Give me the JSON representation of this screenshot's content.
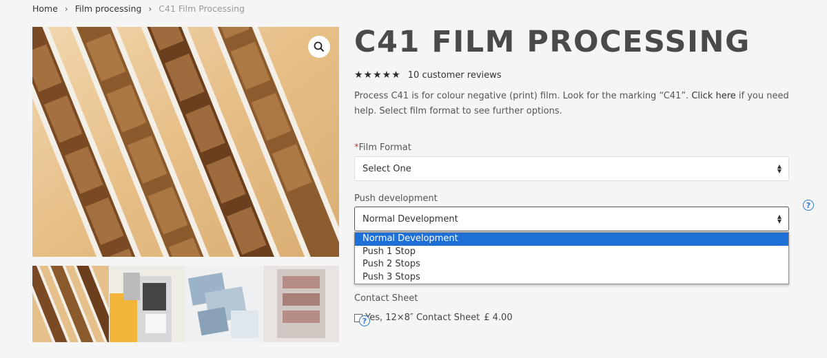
{
  "breadcrumb": {
    "home": "Home",
    "category": "Film processing",
    "current": "C41 Film Processing",
    "separator": "›"
  },
  "gallery": {
    "main_image": "film-strips-photo",
    "zoom_icon": "magnifier-icon",
    "thumbnails": [
      "film-strips-thumb",
      "120-film-roll-thumb",
      "contact-sheets-thumb",
      "negatives-sleeve-thumb"
    ]
  },
  "product": {
    "title": "C41 FILM PROCESSING",
    "stars": "★★★★★",
    "rating": 5,
    "reviews": "10 customer reviews",
    "description_pre": "Process C41 is for colour negative (print) film. Look for the marking “C41”.",
    "description_link": "Click here",
    "description_post": "if you need help. Select film format to see further options."
  },
  "form": {
    "film_format": {
      "required_mark": "*",
      "label": "Film Format",
      "value": "Select One"
    },
    "push": {
      "label": "Push development",
      "value": "Normal Development",
      "options": [
        "Normal Development",
        "Push 1 Stop",
        "Push 2 Stops",
        "Push 3 Stops"
      ],
      "help": "?"
    },
    "contact_sheet": {
      "label": "Contact Sheet",
      "option_label": "Yes, 12×8″ Contact Sheet",
      "price": "£ 4.00",
      "help": "?"
    }
  },
  "colors": {
    "accent": "#1e6fd6",
    "help": "#2d77c9",
    "required": "#c0392b",
    "title": "#4a4a4a"
  }
}
